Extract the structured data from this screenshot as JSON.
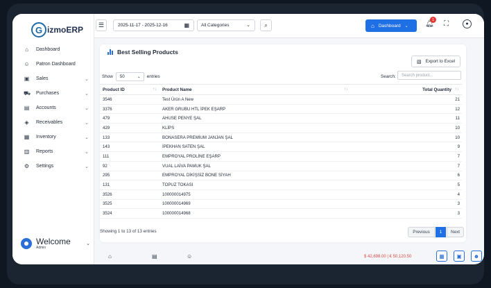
{
  "app": {
    "brand": "izmoERP",
    "brand_letter": "G",
    "brand_suffix": "ERP"
  },
  "sidebar": {
    "items": [
      {
        "label": "Dashboard",
        "icon": "home-icon",
        "glyph": "⌂",
        "chev": ""
      },
      {
        "label": "Patron Dashboard",
        "icon": "user-circle-icon",
        "glyph": "☺",
        "chev": ""
      },
      {
        "label": "Sales",
        "icon": "bag-icon",
        "glyph": "▣",
        "chev": "⌄"
      },
      {
        "label": "Purchases",
        "icon": "cart-icon",
        "glyph": "⛟",
        "chev": "⌄"
      },
      {
        "label": "Accounts",
        "icon": "card-icon",
        "glyph": "▤",
        "chev": "⌄"
      },
      {
        "label": "Receivables",
        "icon": "receipt-icon",
        "glyph": "◈",
        "chev": "⌄"
      },
      {
        "label": "Inventory",
        "icon": "box-icon",
        "glyph": "▦",
        "chev": "⌄"
      },
      {
        "label": "Reports",
        "icon": "chart-icon",
        "glyph": "▥",
        "chev": "⌄"
      },
      {
        "label": "Settings",
        "icon": "gear-icon",
        "glyph": "⚙",
        "chev": "⌄"
      }
    ],
    "welcome": {
      "title": "Welcome",
      "subtitle": "Admin"
    }
  },
  "topbar": {
    "date_range": "2025-11-17  -  2025-12-16",
    "category": "All Categories",
    "dashboard_button": "Dashboard",
    "notification_count": "1"
  },
  "card": {
    "title": "Best Selling Products",
    "export_label": "Export to Excel",
    "show_label": "Show",
    "show_value": "50",
    "entries_label": "entries",
    "search_label": "Search:",
    "search_placeholder": "Search product...",
    "columns": [
      "Product ID",
      "Product Name",
      "Total Quantity"
    ],
    "rows": [
      [
        "3546",
        "Test Ürün A New",
        "21"
      ],
      [
        "3376",
        "AKER GRUBU HTL İPEK EŞARP",
        "12"
      ],
      [
        "479",
        "AHUSE PENYE ŞAL",
        "11"
      ],
      [
        "429",
        "KLİPS",
        "10"
      ],
      [
        "133",
        "BONASERA PREMİUM JANJAN ŞAL",
        "10"
      ],
      [
        "143",
        "İPEKHAN SATEN ŞAL",
        "9"
      ],
      [
        "111",
        "EMPROYAL PROLİNE EŞARP",
        "7"
      ],
      [
        "92",
        "VUAL LAİVA PAMUK ŞAL",
        "7"
      ],
      [
        "295",
        "EMPROYAL DİKİŞSİZ BONE SİYAH",
        "6"
      ],
      [
        "131",
        "TOPUZ TOKASI",
        "5"
      ],
      [
        "3526",
        "100000014975",
        "4"
      ],
      [
        "3525",
        "100000014969",
        "3"
      ],
      [
        "3524",
        "100000014968",
        "3"
      ]
    ],
    "info": "Showing 1 to 13 of 13 entries",
    "pager": {
      "prev": "Previous",
      "current": "1",
      "next": "Next"
    }
  },
  "footer": {
    "totals": "$ 42,698.00  |  € 50,120.50"
  },
  "colors": {
    "accent": "#1f6fe5",
    "danger": "#e53935",
    "totals": "#d94a3d"
  }
}
